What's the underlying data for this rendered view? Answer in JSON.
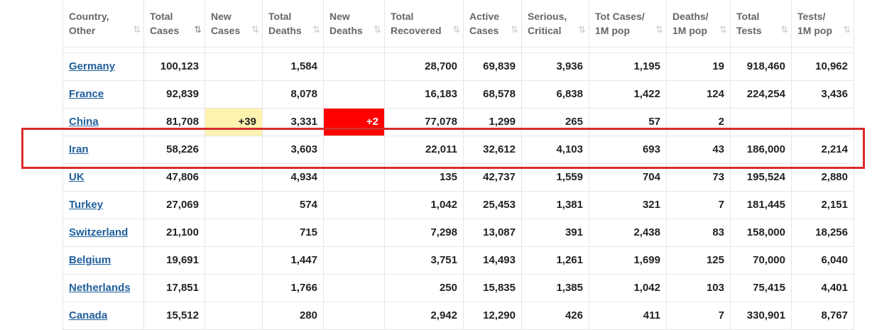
{
  "columns": [
    {
      "line1": "Country,",
      "line2": "Other",
      "sort": "⇅"
    },
    {
      "line1": "Total",
      "line2": "Cases",
      "sort": "⇅"
    },
    {
      "line1": "New",
      "line2": "Cases",
      "sort": "⇅"
    },
    {
      "line1": "Total",
      "line2": "Deaths",
      "sort": "⇅"
    },
    {
      "line1": "New",
      "line2": "Deaths",
      "sort": "⇅"
    },
    {
      "line1": "Total",
      "line2": "Recovered",
      "sort": "⇅"
    },
    {
      "line1": "Active",
      "line2": "Cases",
      "sort": "⇅"
    },
    {
      "line1": "Serious,",
      "line2": "Critical",
      "sort": "⇅"
    },
    {
      "line1": "Tot Cases/",
      "line2": "1M pop",
      "sort": "⇅"
    },
    {
      "line1": "Deaths/",
      "line2": "1M pop",
      "sort": "⇅"
    },
    {
      "line1": "Total",
      "line2": "Tests",
      "sort": "⇅"
    },
    {
      "line1": "Tests/",
      "line2": "1M pop",
      "sort": "⇅"
    }
  ],
  "rows": [
    [
      "Germany",
      "100,123",
      "",
      "1,584",
      "",
      "28,700",
      "69,839",
      "3,936",
      "1,195",
      "19",
      "918,460",
      "10,962"
    ],
    [
      "France",
      "92,839",
      "",
      "8,078",
      "",
      "16,183",
      "68,578",
      "6,838",
      "1,422",
      "124",
      "224,254",
      "3,436"
    ],
    [
      "China",
      "81,708",
      "+39",
      "3,331",
      "+2",
      "77,078",
      "1,299",
      "265",
      "57",
      "2",
      "",
      ""
    ],
    [
      "Iran",
      "58,226",
      "",
      "3,603",
      "",
      "22,011",
      "32,612",
      "4,103",
      "693",
      "43",
      "186,000",
      "2,214"
    ],
    [
      "UK",
      "47,806",
      "",
      "4,934",
      "",
      "135",
      "42,737",
      "1,559",
      "704",
      "73",
      "195,524",
      "2,880"
    ],
    [
      "Turkey",
      "27,069",
      "",
      "574",
      "",
      "1,042",
      "25,453",
      "1,381",
      "321",
      "7",
      "181,445",
      "2,151"
    ],
    [
      "Switzerland",
      "21,100",
      "",
      "715",
      "",
      "7,298",
      "13,087",
      "391",
      "2,438",
      "83",
      "158,000",
      "18,256"
    ],
    [
      "Belgium",
      "19,691",
      "",
      "1,447",
      "",
      "3,751",
      "14,493",
      "1,261",
      "1,699",
      "125",
      "70,000",
      "6,040"
    ],
    [
      "Netherlands",
      "17,851",
      "",
      "1,766",
      "",
      "250",
      "15,835",
      "1,385",
      "1,042",
      "103",
      "75,415",
      "4,401"
    ],
    [
      "Canada",
      "15,512",
      "",
      "280",
      "",
      "2,942",
      "12,290",
      "426",
      "411",
      "7",
      "330,901",
      "8,767"
    ]
  ],
  "highlighted_country": "Iran",
  "colors": {
    "link": "#1f5f9c",
    "new_cases_highlight": "#fff3b0",
    "new_deaths_highlight": "#ff0000",
    "annotation_box": "#d92b2b"
  }
}
